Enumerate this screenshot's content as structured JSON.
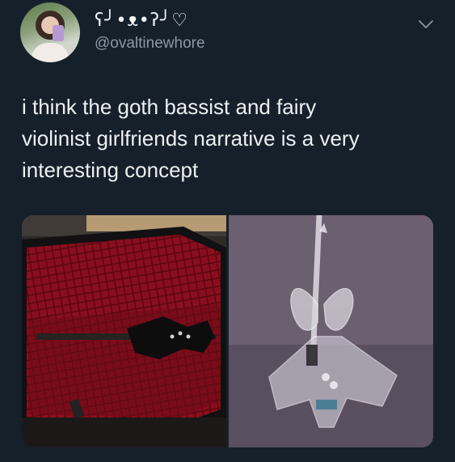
{
  "user": {
    "display_name": "ʕ╯•ᴥ•ʔ╯♡",
    "handle": "@ovaltinewhore"
  },
  "tweet": {
    "text": "i think the goth bassist and fairy\nviolinist girlfriends narrative is a very\ninteresting concept"
  },
  "icons": {
    "more": "chevron-down-icon"
  },
  "colors": {
    "background": "#15202b",
    "text": "#eef0f1",
    "handle": "#8b98a5"
  }
}
